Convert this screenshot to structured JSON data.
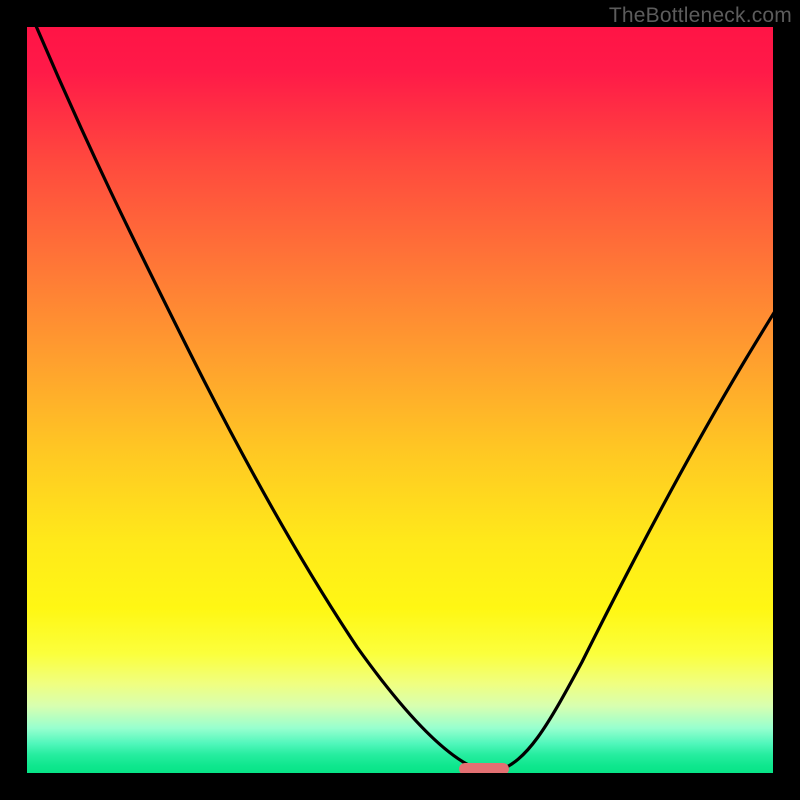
{
  "watermark": {
    "text": "TheBottleneck.com"
  },
  "chart_data": {
    "type": "line",
    "title": "",
    "xlabel": "",
    "ylabel": "",
    "xlim": [
      0,
      100
    ],
    "ylim": [
      0,
      100
    ],
    "grid": false,
    "series": [
      {
        "name": "bottleneck-curve",
        "x": [
          0,
          5,
          10,
          15,
          20,
          25,
          30,
          35,
          40,
          45,
          50,
          55,
          60,
          62,
          64,
          66,
          70,
          75,
          80,
          85,
          90,
          95,
          100
        ],
        "y": [
          100,
          91,
          82,
          73,
          64,
          55,
          46,
          38,
          30,
          22,
          15,
          9,
          4,
          1.5,
          0,
          1.5,
          5,
          12,
          22,
          33,
          44,
          54,
          62
        ]
      }
    ],
    "marker": {
      "name": "optimal-point",
      "x": 63,
      "y": 1,
      "color": "#e86a6a"
    },
    "gradient_scale": {
      "top_color": "#ff1446",
      "bottom_color": "#07e487",
      "meaning": "red = high bottleneck, green = low bottleneck"
    }
  }
}
